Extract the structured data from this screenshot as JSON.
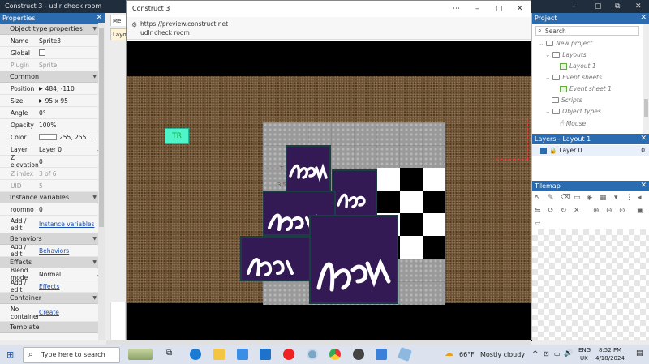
{
  "window": {
    "title": "Construct 3 - udlr check room"
  },
  "properties": {
    "title": "Properties",
    "section_object_type": "Object type properties",
    "name_label": "Name",
    "name_value": "Sprite3",
    "global_label": "Global",
    "plugin_label": "Plugin",
    "plugin_value": "Sprite",
    "section_common": "Common",
    "position_label": "Position",
    "position_value": "484, -110",
    "size_label": "Size",
    "size_value": "95 x 95",
    "angle_label": "Angle",
    "angle_value": "0°",
    "opacity_label": "Opacity",
    "opacity_value": "100%",
    "color_label": "Color",
    "color_value": "255, 255...",
    "layer_label": "Layer",
    "layer_value": "Layer 0",
    "zelev_label": "Z elevation",
    "zelev_value": "0",
    "zindex_label": "Z index",
    "zindex_value": "3 of 6",
    "uid_label": "UID",
    "uid_value": "5",
    "section_instance_vars": "Instance variables",
    "roomno_label": "roomno",
    "roomno_value": "0",
    "add_edit_label": "Add / edit",
    "instance_vars_link": "Instance variables",
    "section_behaviors": "Behaviors",
    "behaviors_link": "Behaviors",
    "section_effects": "Effects",
    "blend_label": "Blend mode",
    "blend_value": "Normal",
    "effects_link": "Effects",
    "section_container": "Container",
    "no_container_label": "No container",
    "create_link": "Create",
    "section_template": "Template"
  },
  "midtabs": [
    "Layo",
    "Me"
  ],
  "browser": {
    "title": "Construct 3",
    "url": "https://preview.construct.net",
    "page_title": "udlr check room",
    "game": {
      "tr_label": "TR",
      "faint_label_1": "T",
      "faint_label_2": "3 5"
    }
  },
  "project": {
    "title": "Project",
    "search_placeholder": "Search",
    "items": [
      "New project",
      "Layouts",
      "Layout 1",
      "Event sheets",
      "Event sheet 1",
      "Scripts",
      "Object types",
      "Mouse"
    ]
  },
  "layers": {
    "title": "Layers - Layout 1",
    "layer_name": "Layer 0",
    "layer_count": "0"
  },
  "tilemap": {
    "title": "Tilemap"
  },
  "taskbar": {
    "search_placeholder": "Type here to search",
    "weather_temp": "66°F",
    "weather_text": "Mostly cloudy",
    "lang_top": "ENG",
    "lang_bottom": "UK",
    "time": "8:52 PM",
    "date": "4/18/2024"
  },
  "colors": {
    "accent": "#2b6cb0",
    "room_tile": "#341a54",
    "tr_box": "#4ff5c8"
  }
}
